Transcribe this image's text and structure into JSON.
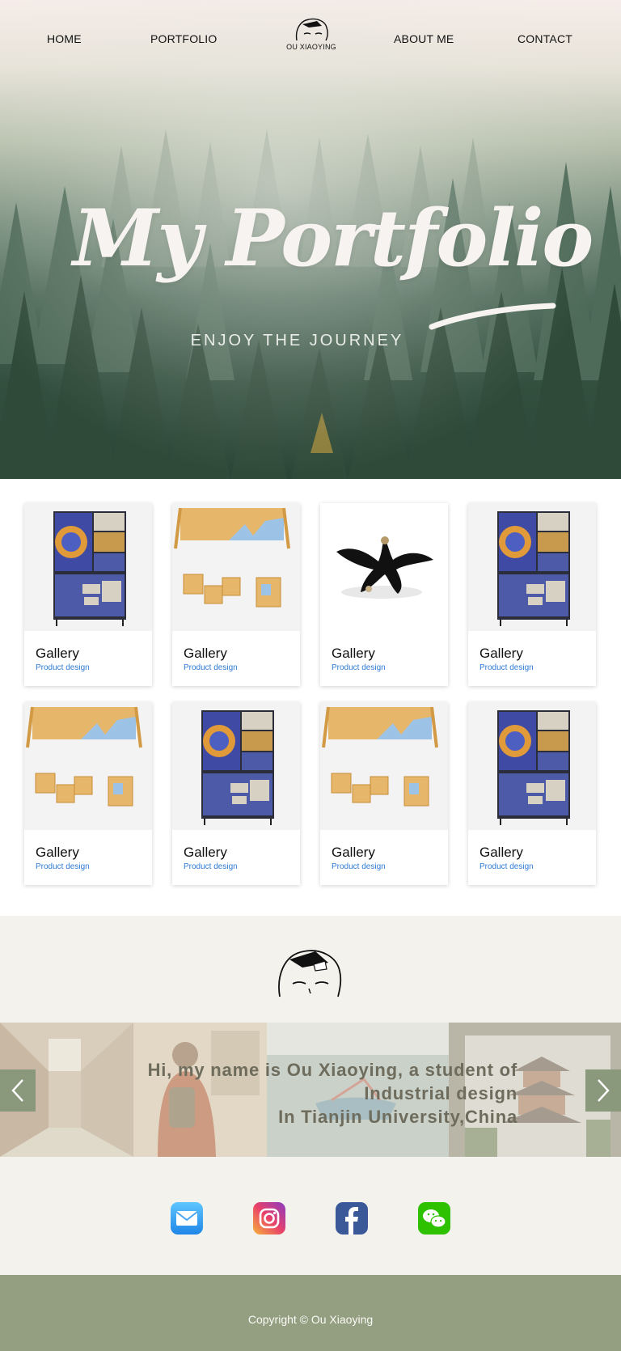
{
  "nav": {
    "home": "HOME",
    "portfolio": "PORTFOLIO",
    "brand": "OU XIAOYING",
    "about": "ABOUT ME",
    "contact": "CONTACT"
  },
  "hero": {
    "title": "My Portfolio",
    "subtitle": "ENJOY THE  JOURNEY"
  },
  "gallery": {
    "cards": [
      {
        "title": "Gallery",
        "subtitle": "Product design",
        "image": "cabinet"
      },
      {
        "title": "Gallery",
        "subtitle": "Product design",
        "image": "shelf"
      },
      {
        "title": "Gallery",
        "subtitle": "Product design",
        "image": "sculpture"
      },
      {
        "title": "Gallery",
        "subtitle": "Product design",
        "image": "cabinet"
      },
      {
        "title": "Gallery",
        "subtitle": "Product design",
        "image": "shelf"
      },
      {
        "title": "Gallery",
        "subtitle": "Product design",
        "image": "cabinet"
      },
      {
        "title": "Gallery",
        "subtitle": "Product design",
        "image": "shelf"
      },
      {
        "title": "Gallery",
        "subtitle": "Product design",
        "image": "cabinet"
      }
    ]
  },
  "about": {
    "intro_line1": "Hi,  my name is Ou Xiaoying,  a student of",
    "intro_line2": "Industrial  design",
    "intro_line3": "In Tianjin University,China",
    "prev_icon": "chevron-left-icon",
    "next_icon": "chevron-right-icon"
  },
  "socials": [
    {
      "name": "mail-icon",
      "color": "#3aa0f0"
    },
    {
      "name": "instagram-icon",
      "color": "#d6307a"
    },
    {
      "name": "facebook-icon",
      "color": "#3b5998"
    },
    {
      "name": "wechat-icon",
      "color": "#2dc100"
    }
  ],
  "footer": {
    "copyright": "Copyright © Ou Xiaoying"
  },
  "colors": {
    "about_bg": "#f4f2ec",
    "footer_bg": "#949e81",
    "link_blue": "#2f7bd6",
    "arrow_bg": "#8a987b"
  }
}
